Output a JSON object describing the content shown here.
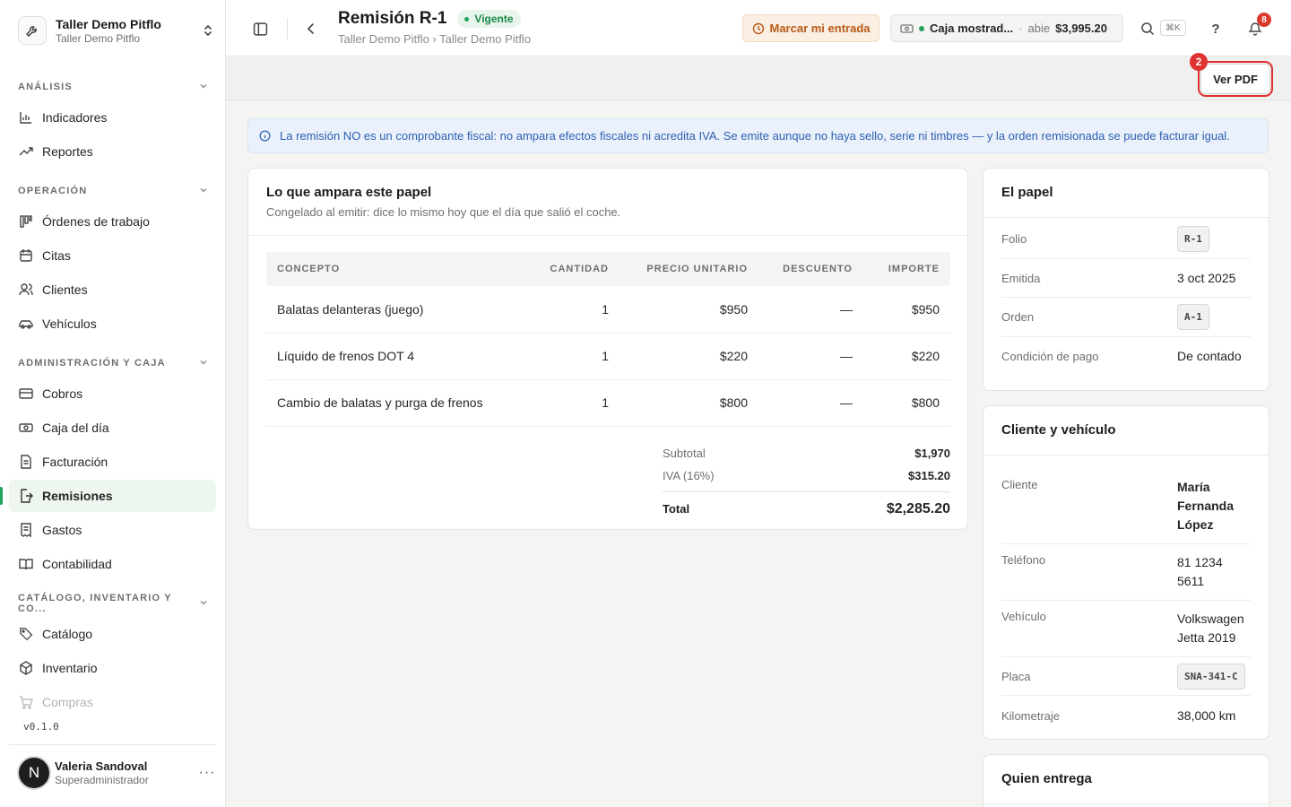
{
  "org": {
    "name": "Taller Demo Pitflo",
    "sub": "Taller Demo Pitflo"
  },
  "sidebar": {
    "sections": [
      {
        "title": "ANÁLISIS",
        "items": [
          "Indicadores",
          "Reportes"
        ]
      },
      {
        "title": "OPERACIÓN",
        "items": [
          "Órdenes de trabajo",
          "Citas",
          "Clientes",
          "Vehículos"
        ]
      },
      {
        "title": "ADMINISTRACIÓN Y CAJA",
        "items": [
          "Cobros",
          "Caja del día",
          "Facturación",
          "Remisiones",
          "Gastos",
          "Contabilidad"
        ]
      },
      {
        "title": "CATÁLOGO, INVENTARIO Y CO...",
        "items": [
          "Catálogo",
          "Inventario",
          "Compras"
        ]
      }
    ],
    "active_item": "Remisiones",
    "version": "v0.1.0"
  },
  "user": {
    "initial": "N",
    "name": "Valeria Sandoval",
    "role": "Superadministrador"
  },
  "header": {
    "title": "Remisión R-1",
    "status": "Vigente",
    "breadcrumb": "Taller Demo Pitflo › Taller Demo Pitflo",
    "clock_in_label": "Marcar mi entrada",
    "cash": {
      "name": "Caja mostrad...",
      "separator": "·",
      "state": "abie",
      "amount": "$3,995.20"
    },
    "search_shortcut": "⌘K",
    "help_label": "?",
    "notifications_count": "8"
  },
  "actions": {
    "view_pdf_label": "Ver PDF",
    "step_badge": "2"
  },
  "banner": {
    "text": "La remisión NO es un comprobante fiscal: no ampara efectos fiscales ni acredita IVA. Se emite aunque no haya sello, serie ni timbres — y la orden remisionada se puede facturar igual."
  },
  "items_card": {
    "title": "Lo que ampara este papel",
    "subtitle": "Congelado al emitir: dice lo mismo hoy que el día que salió el coche.",
    "columns": [
      "CONCEPTO",
      "CANTIDAD",
      "PRECIO UNITARIO",
      "DESCUENTO",
      "IMPORTE"
    ],
    "rows": [
      [
        "Balatas delanteras (juego)",
        "1",
        "$950",
        "—",
        "$950"
      ],
      [
        "Líquido de frenos DOT 4",
        "1",
        "$220",
        "—",
        "$220"
      ],
      [
        "Cambio de balatas y purga de frenos",
        "1",
        "$800",
        "—",
        "$800"
      ]
    ],
    "totals": {
      "subtotal_label": "Subtotal",
      "subtotal": "$1,970",
      "iva_label": "IVA (16%)",
      "iva": "$315.20",
      "total_label": "Total",
      "total": "$2,285.20"
    }
  },
  "paper_card": {
    "title": "El papel",
    "folio_label": "Folio",
    "folio": "R-1",
    "issued_label": "Emitida",
    "issued": "3 oct 2025",
    "order_label": "Orden",
    "order": "A-1",
    "payment_label": "Condición de pago",
    "payment": "De contado"
  },
  "client_card": {
    "title": "Cliente y vehículo",
    "client_label": "Cliente",
    "client": "María Fernanda López",
    "phone_label": "Teléfono",
    "phone": "81 1234 5611",
    "vehicle_label": "Vehículo",
    "vehicle": "Volkswagen Jetta 2019",
    "plate_label": "Placa",
    "plate": "SNA-341-C",
    "km_label": "Kilometraje",
    "km": "38,000 km"
  },
  "delivery_card": {
    "title": "Quien entrega"
  },
  "colors": {
    "accent": "#1fa35b",
    "danger": "#e03131",
    "info": "#2c5fb0",
    "warning": "#b85a16"
  }
}
